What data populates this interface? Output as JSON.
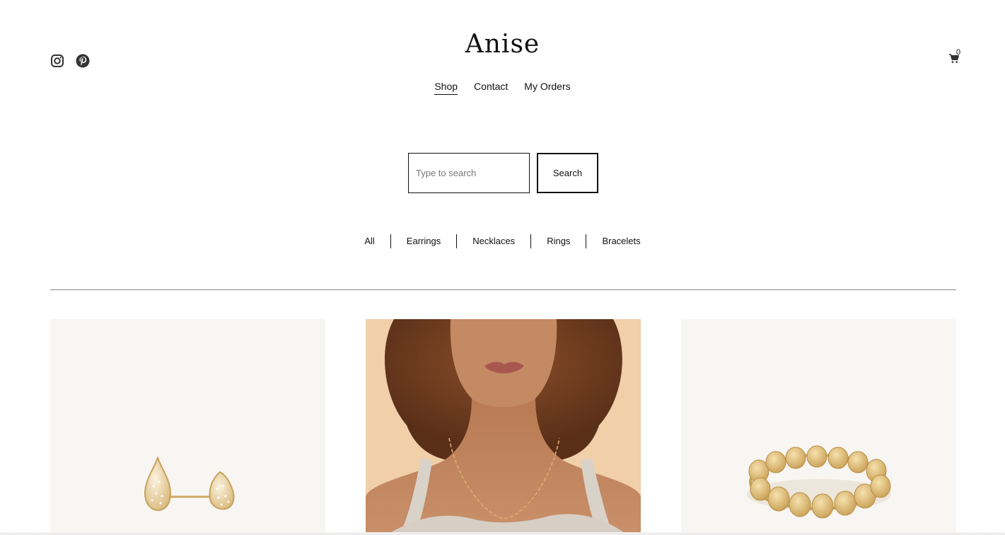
{
  "header": {
    "brand": "Anise",
    "social": [
      {
        "icon": "instagram-icon"
      },
      {
        "icon": "pinterest-icon"
      }
    ],
    "nav": [
      {
        "label": "Shop",
        "active": true
      },
      {
        "label": "Contact",
        "active": false
      },
      {
        "label": "My Orders",
        "active": false
      }
    ],
    "cart": {
      "icon": "cart-icon",
      "count": "0"
    }
  },
  "search": {
    "placeholder": "Type to search",
    "value": "",
    "button_label": "Search"
  },
  "filters": [
    "All",
    "Earrings",
    "Necklaces",
    "Rings",
    "Bracelets"
  ],
  "products": [
    {
      "image": "pave-teardrop-stud-earrings"
    },
    {
      "image": "model-wearing-gold-chain-necklace"
    },
    {
      "image": "gold-disc-stacking-ring"
    }
  ],
  "colors": {
    "text": "#111111",
    "product_bg": "#f8f6f2",
    "model_bg": "#f0cfa9",
    "gold": "#d9b071"
  }
}
